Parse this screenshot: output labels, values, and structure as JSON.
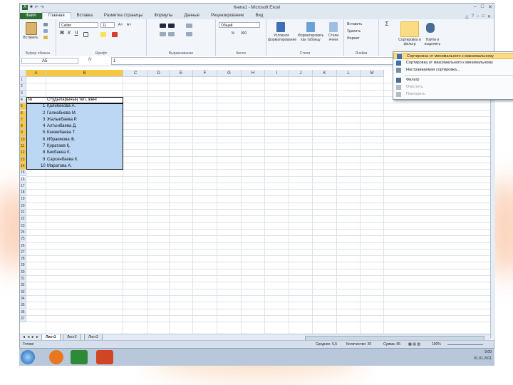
{
  "window": {
    "title": "Книга1 - Microsoft Excel",
    "qat_icons": [
      "save-icon",
      "undo-icon",
      "redo-icon"
    ],
    "controls": [
      "–",
      "□",
      "✕"
    ],
    "help_icons": [
      "△",
      "?",
      "–",
      "□",
      "✕"
    ]
  },
  "tabs": [
    "Файл",
    "Главная",
    "Вставка",
    "Разметка страницы",
    "Формулы",
    "Данные",
    "Рецензирование",
    "Вид"
  ],
  "ribbon": {
    "clipboard": {
      "paste": "Вставить",
      "label": "Буфер обмена"
    },
    "font": {
      "name": "Calibri",
      "size": "11",
      "label": "Шрифт",
      "bold": "Ж",
      "italic": "К",
      "underline": "Ч",
      "grow": "A˄",
      "shrink": "A˅"
    },
    "align": {
      "label": "Выравнивание"
    },
    "number": {
      "format": "Общий",
      "label": "Число",
      "percent": "%",
      "thousands": "000"
    },
    "styles": {
      "conditional": "Условное форматирование",
      "table": "Форматировать как таблицу",
      "cell": "Стили ячеек",
      "label": "Стили"
    },
    "cells": {
      "insert": "Вставить",
      "delete": "Удалить",
      "format": "Формат",
      "label": "Ячейки"
    },
    "editing": {
      "sum": "Σ",
      "sort": "Сортировка и фильтр",
      "find": "Найти и выделить"
    }
  },
  "formula_bar": {
    "namebox": "A5",
    "fx": "fx",
    "value": "1"
  },
  "columns": [
    "A",
    "B",
    "C",
    "D",
    "E",
    "F",
    "G",
    "H",
    "I",
    "J",
    "K",
    "L",
    "M"
  ],
  "rows": [
    "1",
    "2",
    "3",
    "4",
    "5",
    "6",
    "7",
    "8",
    "9",
    "10",
    "11",
    "12",
    "13",
    "14",
    "15",
    "16",
    "17",
    "18",
    "19",
    "20",
    "21",
    "22",
    "23",
    "24",
    "25",
    "26",
    "27",
    "28",
    "29",
    "30",
    "31",
    "32",
    "33",
    "34",
    "35",
    "36",
    "37"
  ],
  "sheet_cells": {
    "header_num": "№",
    "header_name": "Студыларының тегі, жөні",
    "students": [
      {
        "n": "1",
        "name": "Қалибекова А."
      },
      {
        "n": "2",
        "name": "Галиабиева М."
      },
      {
        "n": "3",
        "name": "Жалыкбаева Р."
      },
      {
        "n": "4",
        "name": "Алтынбаева Д."
      },
      {
        "n": "5",
        "name": "Кенжебаева Т."
      },
      {
        "n": "6",
        "name": "Ибраимова Ф."
      },
      {
        "n": "7",
        "name": "Қоратаев Қ."
      },
      {
        "n": "8",
        "name": "Бекбаева К."
      },
      {
        "n": "9",
        "name": "Сарсенбаева К."
      },
      {
        "n": "10",
        "name": "Маратова А."
      }
    ]
  },
  "dropdown": {
    "items": [
      {
        "label": "Сортировка от минимального к максимальному",
        "icon": "sort-asc-icon",
        "state": "highlighted"
      },
      {
        "label": "Сортировка от максимального к минимальному",
        "icon": "sort-desc-icon",
        "state": "normal"
      },
      {
        "label": "Настраиваемая сортировка...",
        "icon": "custom-sort-icon",
        "state": "normal"
      },
      {
        "label": "Фильтр",
        "icon": "filter-icon",
        "state": "normal"
      },
      {
        "label": "Очистить",
        "icon": "clear-filter-icon",
        "state": "disabled"
      },
      {
        "label": "Повторить",
        "icon": "reapply-icon",
        "state": "disabled"
      }
    ]
  },
  "sheet_tabs": [
    "Лист1",
    "Лист2",
    "Лист3"
  ],
  "statusbar": {
    "ready": "Готово",
    "average": "Среднее: 5,5",
    "count": "Количество: 20",
    "sum": "Сумма: 55",
    "zoom": "100%"
  },
  "taskbar": {
    "time": "9:00",
    "date": "01.01.2011"
  },
  "colors": {
    "selection": "#bcd7f4",
    "highlight_header": "#f6c743",
    "file_tab": "#2d6a2f"
  }
}
